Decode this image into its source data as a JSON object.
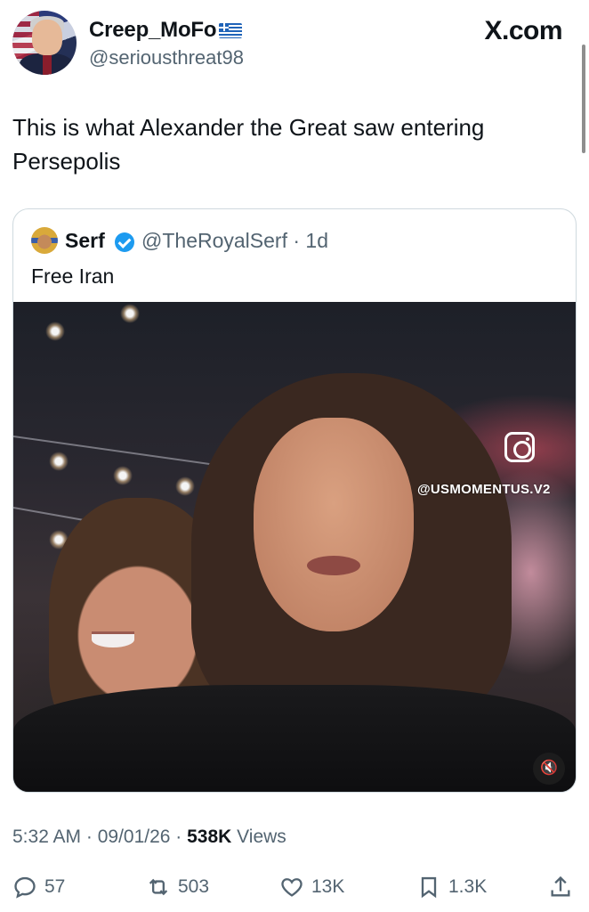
{
  "author": {
    "display_name": "Creep_MoFo",
    "handle": "@seriousthreat98"
  },
  "site_logo": "X.com",
  "tweet": {
    "text": "This is what Alexander the Great saw entering Persepolis"
  },
  "quoted": {
    "name": "Serf",
    "handle_time": "@TheRoyalSerf · 1d",
    "text": "Free Iran",
    "watermark": "@USMOMENTUS.V2",
    "icons": [
      "verified-badge-icon",
      "instagram-icon",
      "mute-icon"
    ]
  },
  "meta": {
    "time_date": "5:32 AM · 09/01/26 · ",
    "views_count": "538K",
    "views_label": " Views"
  },
  "actions": {
    "replies": "57",
    "reposts": "503",
    "likes": "13K",
    "bookmarks": "1.3K"
  },
  "colors": {
    "text": "#0f1419",
    "secondary": "#536471",
    "verified": "#1d9bf0",
    "border": "#cfd9de"
  }
}
